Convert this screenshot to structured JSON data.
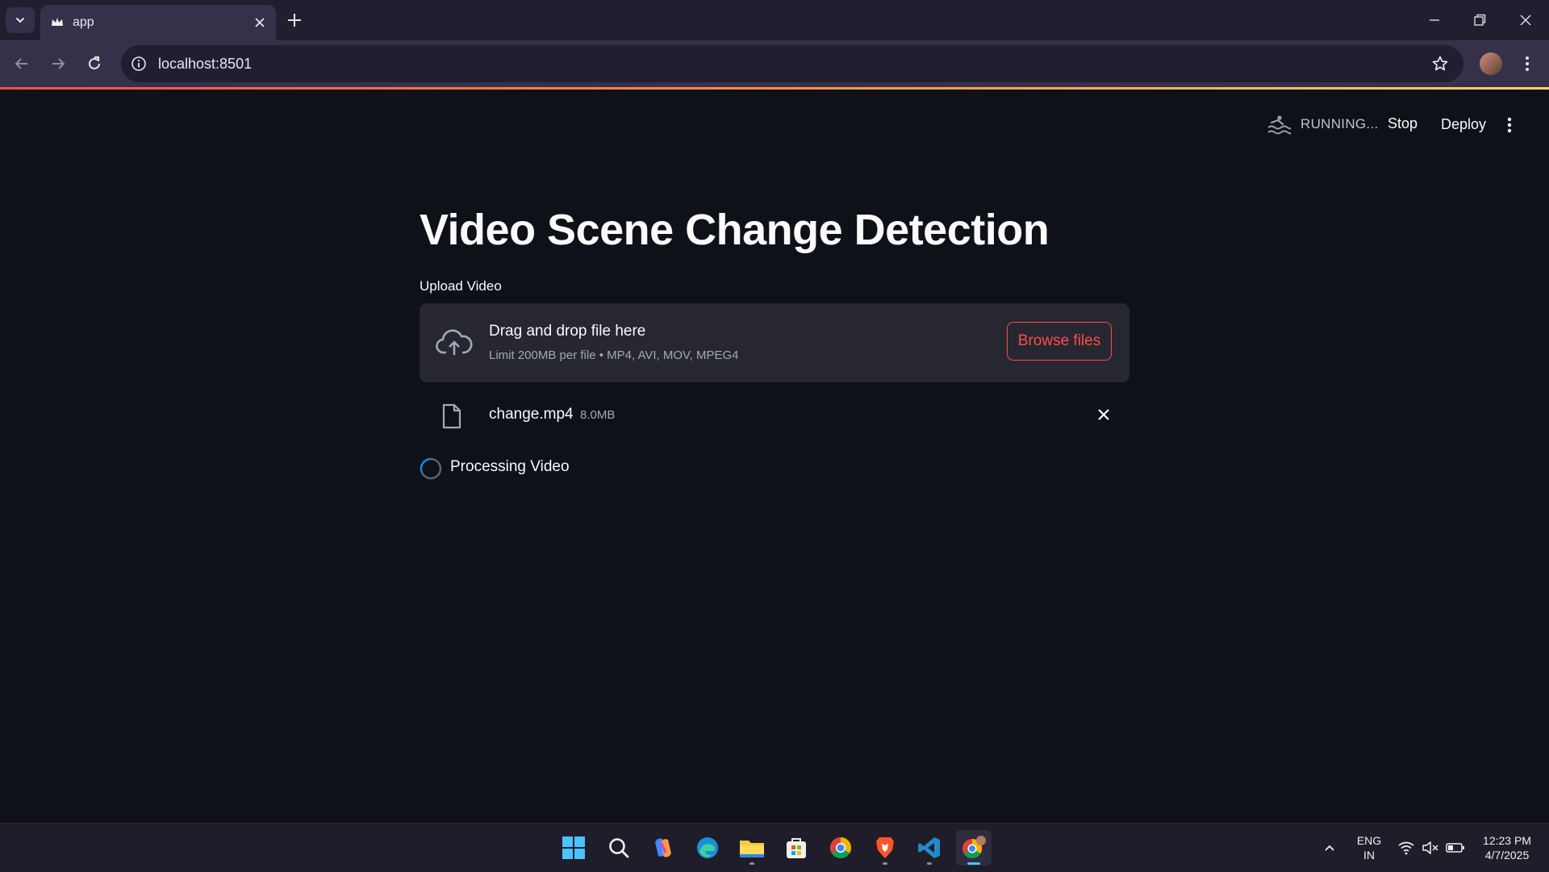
{
  "browser": {
    "tab_title": "app",
    "url": "localhost:8501"
  },
  "app_header": {
    "status": "RUNNING...",
    "stop_label": "Stop",
    "deploy_label": "Deploy"
  },
  "main": {
    "title": "Video Scene Change Detection",
    "uploader": {
      "label": "Upload Video",
      "drop_text": "Drag and drop file here",
      "limit_text": "Limit 200MB per file • MP4, AVI, MOV, MPEG4",
      "browse_label": "Browse files"
    },
    "file": {
      "name": "change.mp4",
      "size": "8.0MB"
    },
    "spinner_text": "Processing Video"
  },
  "taskbar": {
    "apps": [
      "start-icon",
      "search-icon",
      "copilot-icon",
      "edge-icon",
      "file-explorer-icon",
      "store-icon",
      "chrome-icon",
      "brave-icon",
      "vscode-icon",
      "chrome-profile-icon"
    ],
    "language_top": "ENG",
    "language_bottom": "IN",
    "time": "12:23 PM",
    "date": "4/7/2025"
  },
  "colors": {
    "app_background": "#0e1117",
    "dropzone_background": "#262730",
    "accent": "#ff4b4b",
    "spinner": "#1c83e1"
  }
}
